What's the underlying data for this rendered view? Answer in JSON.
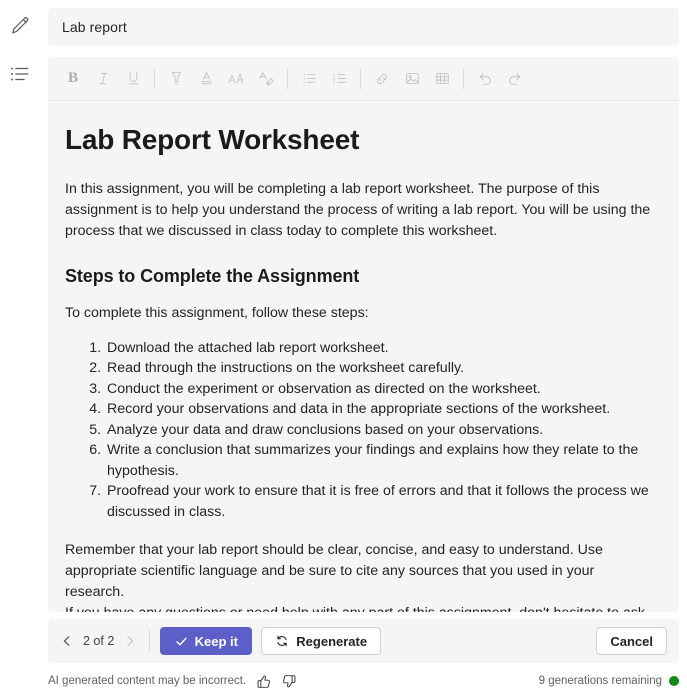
{
  "rail": {
    "items": [
      {
        "name": "edit-pencil",
        "tooltip": "Edit"
      },
      {
        "name": "list-outline",
        "tooltip": "Outline"
      }
    ]
  },
  "title_field": {
    "value": "Lab report",
    "placeholder": "Title"
  },
  "toolbar": {
    "groups": [
      [
        {
          "name": "bold-button",
          "label": "B",
          "icon": "bold-icon"
        },
        {
          "name": "italic-button",
          "label": "I",
          "icon": "italic-icon"
        },
        {
          "name": "underline-button",
          "label": "U",
          "icon": "underline-icon"
        }
      ],
      [
        {
          "name": "highlight-button",
          "label": "Highlight",
          "icon": "highlight-icon"
        },
        {
          "name": "font-color-button",
          "label": "Font color",
          "icon": "font-color-icon"
        },
        {
          "name": "font-size-button",
          "label": "Font size",
          "icon": "font-size-icon"
        },
        {
          "name": "clear-formatting-button",
          "label": "Clear formatting",
          "icon": "clear-formatting-icon"
        }
      ],
      [
        {
          "name": "bulleted-list-button",
          "label": "Bulleted list",
          "icon": "bulleted-list-icon"
        },
        {
          "name": "numbered-list-button",
          "label": "Numbered list",
          "icon": "numbered-list-icon"
        }
      ],
      [
        {
          "name": "link-button",
          "label": "Insert link",
          "icon": "link-icon"
        },
        {
          "name": "image-button",
          "label": "Insert image",
          "icon": "image-icon"
        },
        {
          "name": "table-button",
          "label": "Insert table",
          "icon": "table-icon"
        }
      ],
      [
        {
          "name": "undo-button",
          "label": "Undo",
          "icon": "undo-icon"
        },
        {
          "name": "redo-button",
          "label": "Redo",
          "icon": "redo-icon"
        }
      ]
    ]
  },
  "document": {
    "heading": "Lab Report Worksheet",
    "intro": "In this assignment, you will be completing a lab report worksheet. The purpose of this assignment is to help you understand the process of writing a lab report. You will be using the process that we discussed in class today to complete this worksheet.",
    "section_heading": "Steps to Complete the Assignment",
    "steps_lead": "To complete this assignment, follow these steps:",
    "steps": [
      "Download the attached lab report worksheet.",
      "Read through the instructions on the worksheet carefully.",
      "Conduct the experiment or observation as directed on the worksheet.",
      "Record your observations and data in the appropriate sections of the worksheet.",
      "Analyze your data and draw conclusions based on your observations.",
      "Write a conclusion that summarizes your findings and explains how they relate to the hypothesis.",
      "Proofread your work to ensure that it is free of errors and that it follows the process we discussed in class."
    ],
    "closing_1": "Remember that your lab report should be clear, concise, and easy to understand. Use appropriate scientific language and be sure to cite any sources that you used in your research.",
    "closing_2": "If you have any questions or need help with any part of this assignment, don't hesitate to ask your teacher or TA. Good luck!"
  },
  "actions": {
    "pager": {
      "prev_icon": "chevron-left-icon",
      "next_icon": "chevron-right-icon",
      "label": "2 of 2",
      "current": 2,
      "total": 2,
      "next_disabled": true
    },
    "keep_it": {
      "label": "Keep it",
      "icon": "checkmark-icon",
      "color": "#5b5fc7"
    },
    "regenerate": {
      "label": "Regenerate",
      "icon": "arrow-sync-icon"
    },
    "cancel": {
      "label": "Cancel"
    }
  },
  "footer": {
    "disclaimer": "AI generated content may be incorrect.",
    "thumbs_up_icon": "thumbs-up-icon",
    "thumbs_down_icon": "thumbs-down-icon",
    "generations_remaining": "9 generations remaining",
    "status_color": "#13891c"
  }
}
